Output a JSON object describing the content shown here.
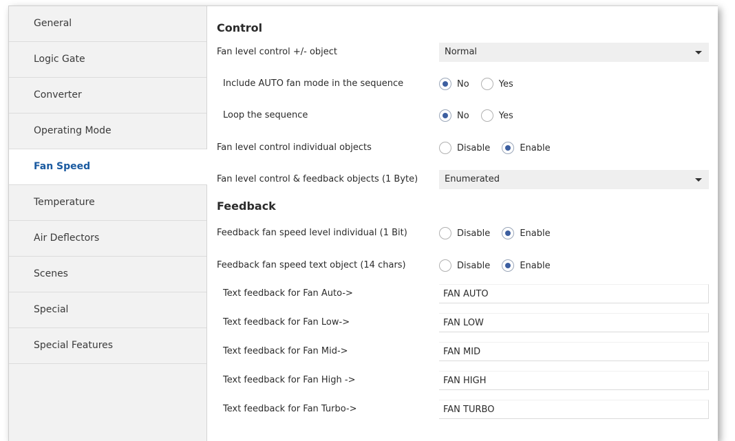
{
  "sidebar": {
    "items": [
      {
        "label": "General"
      },
      {
        "label": "Logic Gate"
      },
      {
        "label": "Converter"
      },
      {
        "label": "Operating Mode"
      },
      {
        "label": "Fan Speed"
      },
      {
        "label": "Temperature"
      },
      {
        "label": "Air Deflectors"
      },
      {
        "label": "Scenes"
      },
      {
        "label": "Special"
      },
      {
        "label": "Special Features"
      }
    ],
    "active_index": 4
  },
  "control": {
    "title": "Control",
    "fan_level_pm_label": "Fan level control +/- object",
    "fan_level_pm_value": "Normal",
    "include_auto_label": "Include AUTO fan mode in the sequence",
    "include_auto_selected": "No",
    "loop_label": "Loop the sequence",
    "loop_selected": "No",
    "individual_label": "Fan level control individual objects",
    "individual_selected": "Enable",
    "byte_label": "Fan level control & feedback objects (1 Byte)",
    "byte_value": "Enumerated"
  },
  "feedback": {
    "title": "Feedback",
    "individual_label": "Feedback fan speed level individual (1 Bit)",
    "individual_selected": "Enable",
    "text_object_label": "Feedback fan speed text object (14 chars)",
    "text_object_selected": "Enable",
    "texts": [
      {
        "label": "Text feedback for Fan Auto->",
        "value": "FAN AUTO"
      },
      {
        "label": "Text feedback for Fan Low->",
        "value": "FAN LOW"
      },
      {
        "label": "Text feedback for Fan Mid->",
        "value": "FAN MID"
      },
      {
        "label": "Text feedback for Fan High ->",
        "value": "FAN HIGH"
      },
      {
        "label": "Text feedback for Fan Turbo->",
        "value": "FAN TURBO"
      }
    ]
  },
  "options": {
    "no": "No",
    "yes": "Yes",
    "disable": "Disable",
    "enable": "Enable"
  },
  "colors": {
    "accent": "#1a5aa0",
    "radio_dot": "#3d5fa0"
  },
  "icons": {
    "dropdown": "chevron-down-icon"
  }
}
